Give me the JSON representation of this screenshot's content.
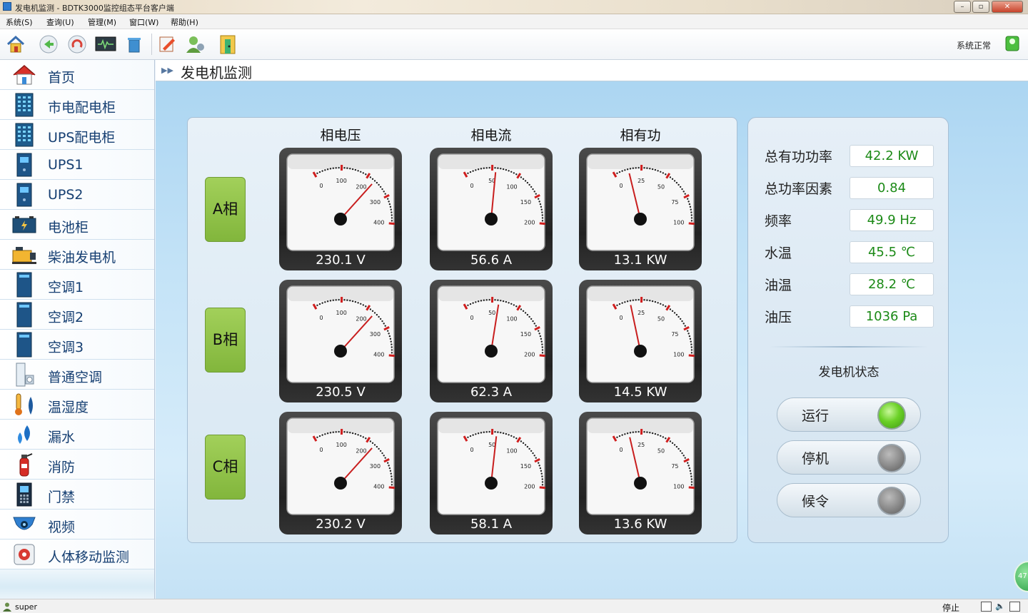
{
  "window": {
    "title": "发电机监测 - BDTK3000监控组态平台客户端",
    "buttons": {
      "minimize": "–",
      "maximize": "▫",
      "close": "✕"
    }
  },
  "menu": [
    "系统(S)",
    "查询(U)",
    "管理(M)",
    "窗口(W)",
    "帮助(H)"
  ],
  "toolbar": {
    "icons": [
      "home-icon",
      "back-icon",
      "refresh-icon",
      "monitor-icon",
      "trash-icon",
      "edit-icon",
      "users-icon",
      "exit-icon"
    ],
    "status_text": "系统正常"
  },
  "sidebar": {
    "items": [
      {
        "label": "首页",
        "icon": "home-icon"
      },
      {
        "label": "市电配电柜",
        "icon": "cabinet-icon"
      },
      {
        "label": "UPS配电柜",
        "icon": "cabinet-icon"
      },
      {
        "label": "UPS1",
        "icon": "ups-icon"
      },
      {
        "label": "UPS2",
        "icon": "ups-icon"
      },
      {
        "label": "电池柜",
        "icon": "battery-icon"
      },
      {
        "label": "柴油发电机",
        "icon": "generator-icon"
      },
      {
        "label": "空调1",
        "icon": "ac-icon"
      },
      {
        "label": "空调2",
        "icon": "ac-icon"
      },
      {
        "label": "空调3",
        "icon": "ac-icon"
      },
      {
        "label": "普通空调",
        "icon": "split-ac-icon"
      },
      {
        "label": "温湿度",
        "icon": "thermometer-icon"
      },
      {
        "label": "漏水",
        "icon": "water-drop-icon"
      },
      {
        "label": "消防",
        "icon": "fire-extinguisher-icon"
      },
      {
        "label": "门禁",
        "icon": "access-control-icon"
      },
      {
        "label": "视频",
        "icon": "camera-icon"
      },
      {
        "label": "人体移动监测",
        "icon": "motion-sensor-icon"
      }
    ]
  },
  "page": {
    "title": "发电机监测",
    "columns": [
      "相电压",
      "相电流",
      "相有功"
    ],
    "phases": [
      {
        "label": "A相",
        "gauges": [
          {
            "readout": "230.1 V",
            "value": 230.1,
            "max": 400,
            "ticks": [
              "0",
              "100",
              "200",
              "300",
              "400"
            ]
          },
          {
            "readout": "56.6 A",
            "value": 56.6,
            "max": 200,
            "ticks": [
              "0",
              "50",
              "100",
              "150",
              "200"
            ]
          },
          {
            "readout": "13.1 KW",
            "value": 13.1,
            "max": 100,
            "ticks": [
              "0",
              "25",
              "50",
              "75",
              "100"
            ]
          }
        ]
      },
      {
        "label": "B相",
        "gauges": [
          {
            "readout": "230.5 V",
            "value": 230.5,
            "max": 400,
            "ticks": [
              "0",
              "100",
              "200",
              "300",
              "400"
            ]
          },
          {
            "readout": "62.3 A",
            "value": 62.3,
            "max": 200,
            "ticks": [
              "0",
              "50",
              "100",
              "150",
              "200"
            ]
          },
          {
            "readout": "14.5 KW",
            "value": 14.5,
            "max": 100,
            "ticks": [
              "0",
              "25",
              "50",
              "75",
              "100"
            ]
          }
        ]
      },
      {
        "label": "C相",
        "gauges": [
          {
            "readout": "230.2 V",
            "value": 230.2,
            "max": 400,
            "ticks": [
              "0",
              "100",
              "200",
              "300",
              "400"
            ]
          },
          {
            "readout": "58.1 A",
            "value": 58.1,
            "max": 200,
            "ticks": [
              "0",
              "50",
              "100",
              "150",
              "200"
            ]
          },
          {
            "readout": "13.6 KW",
            "value": 13.6,
            "max": 100,
            "ticks": [
              "0",
              "25",
              "50",
              "75",
              "100"
            ]
          }
        ]
      }
    ],
    "info": [
      {
        "label": "总有功功率",
        "value": "42.2 KW"
      },
      {
        "label": "总功率因素",
        "value": "0.84"
      },
      {
        "label": "频率",
        "value": "49.9 Hz"
      },
      {
        "label": "水温",
        "value": "45.5 ℃"
      },
      {
        "label": "油温",
        "value": "28.2 ℃"
      },
      {
        "label": "油压",
        "value": "1036 Pa"
      }
    ],
    "gen_state_title": "发电机状态",
    "states": [
      {
        "label": "运行",
        "on": true
      },
      {
        "label": "停机",
        "on": false
      },
      {
        "label": "候令",
        "on": false
      }
    ],
    "float_badge": "47"
  },
  "statusbar": {
    "user": "super",
    "stop": "停止"
  },
  "colors": {
    "value_green": "#1c8a17",
    "phase_green": "#8cc243",
    "nav_text": "#163f72",
    "needle": "#c81e1e"
  }
}
